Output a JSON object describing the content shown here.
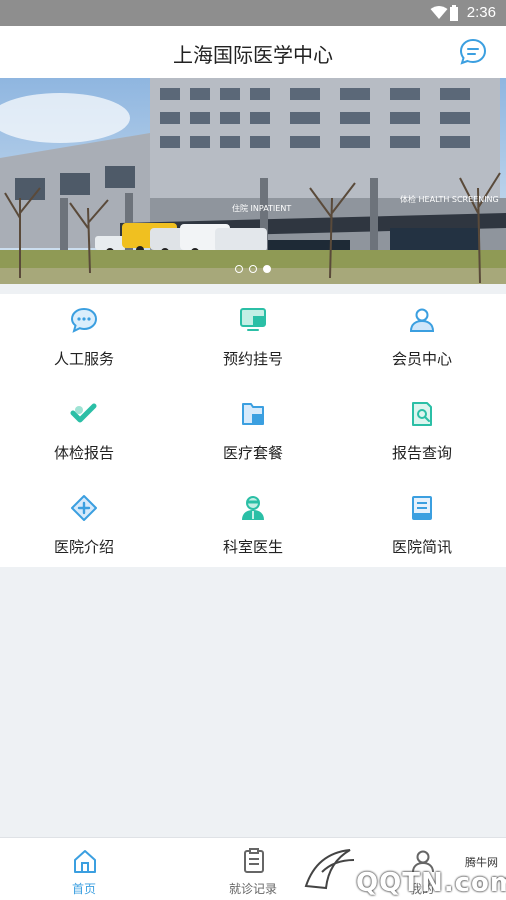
{
  "status_bar": {
    "time": "2:36"
  },
  "header": {
    "title": "上海国际医学中心",
    "message_icon": "chat-bubble-icon"
  },
  "banner": {
    "signs": {
      "left": "住院 INPATIENT",
      "right": "体检 HEALTH SCREENING"
    },
    "pages": 3,
    "active_page": 3
  },
  "services": [
    {
      "label": "人工服务",
      "icon": "chat-service-icon"
    },
    {
      "label": "预约挂号",
      "icon": "monitor-booking-icon"
    },
    {
      "label": "会员中心",
      "icon": "member-user-icon"
    },
    {
      "label": "体检报告",
      "icon": "checkup-report-icon"
    },
    {
      "label": "医疗套餐",
      "icon": "medical-package-icon"
    },
    {
      "label": "报告查询",
      "icon": "report-search-icon"
    },
    {
      "label": "医院介绍",
      "icon": "hospital-intro-icon"
    },
    {
      "label": "科室医生",
      "icon": "doctor-icon"
    },
    {
      "label": "医院简讯",
      "icon": "hospital-news-icon"
    }
  ],
  "tabbar": {
    "items": [
      {
        "label": "首页",
        "icon": "home-icon",
        "active": true
      },
      {
        "label": "就诊记录",
        "icon": "records-icon",
        "active": false
      },
      {
        "label": "我的",
        "icon": "user-icon",
        "active": false
      }
    ]
  },
  "watermark": {
    "small": "腾牛网",
    "big": "QQTN.com"
  },
  "colors": {
    "accent": "#3b9fe0",
    "teal": "#2bbfa6",
    "background": "#eef1f4"
  }
}
